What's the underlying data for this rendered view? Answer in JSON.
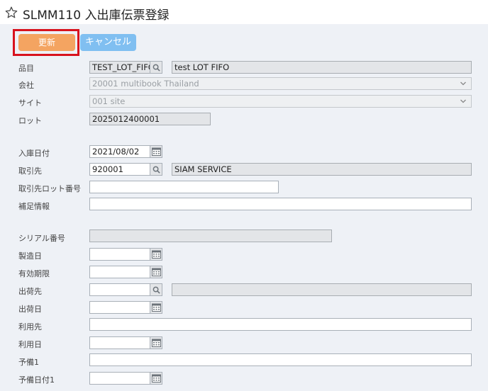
{
  "header": {
    "title": "SLMM110 入出庫伝票登録"
  },
  "buttons": {
    "update": "更新",
    "cancel": "キャンセル"
  },
  "form": {
    "item": {
      "label": "品目",
      "code": "TEST_LOT_FIFO",
      "name": "test LOT FIFO"
    },
    "company": {
      "label": "会社",
      "value": "20001 multibook Thailand"
    },
    "site": {
      "label": "サイト",
      "value": "001 site"
    },
    "lot": {
      "label": "ロット",
      "value": "2025012400001"
    },
    "receipt_date": {
      "label": "入庫日付",
      "value": "2021/08/02"
    },
    "partner": {
      "label": "取引先",
      "code": "920001",
      "name": "SIAM SERVICE"
    },
    "partner_lot": {
      "label": "取引先ロット番号",
      "value": ""
    },
    "supplementary": {
      "label": "補足情報",
      "value": ""
    },
    "serial": {
      "label": "シリアル番号",
      "value": ""
    },
    "mfg_date": {
      "label": "製造日",
      "value": ""
    },
    "expiry": {
      "label": "有効期限",
      "value": ""
    },
    "ship_to": {
      "label": "出荷先",
      "code": "",
      "name": ""
    },
    "ship_date": {
      "label": "出荷日",
      "value": ""
    },
    "use_dest": {
      "label": "利用先",
      "value": ""
    },
    "use_date": {
      "label": "利用日",
      "value": ""
    },
    "reserve1": {
      "label": "予備1",
      "value": ""
    },
    "reserve_date1": {
      "label": "予備日付1",
      "value": ""
    }
  },
  "colors": {
    "update_button": "#f4a461",
    "cancel_button": "#80bff1",
    "highlight_border": "#d8121e",
    "panel_bg": "#eef1f6"
  }
}
